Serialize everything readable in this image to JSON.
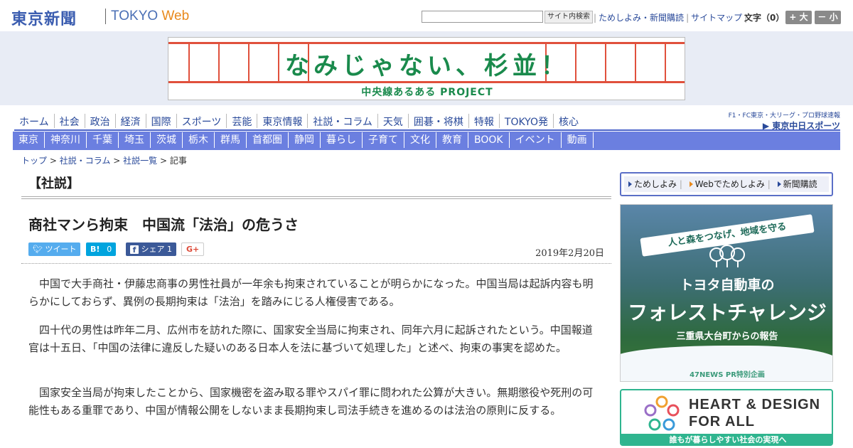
{
  "header": {
    "logo_jp": "東京新聞",
    "logo_tokyo": "TOKYO",
    "logo_web": "Web",
    "search_button": "サイト内検索",
    "links": [
      "ためしよみ・新聞購読",
      "サイトマップ"
    ],
    "font_size_label": "文字（0）",
    "font_plus": "+ 大",
    "font_minus": "－ 小"
  },
  "banner": {
    "title": "なみじゃない、杉並！",
    "subtitle": "中央線あるある PROJECT"
  },
  "nav_main": [
    "ホーム",
    "社会",
    "政治",
    "経済",
    "国際",
    "スポーツ",
    "芸能",
    "東京情報",
    "社説・コラム",
    "天気",
    "囲碁・将棋",
    "特報",
    "TOKYO発",
    "核心"
  ],
  "sports_link": {
    "line1": "F1・FC東京・大リーグ・プロ野球速報",
    "line2": "▶ 東京中日スポーツ"
  },
  "nav_regions": [
    "東京",
    "神奈川",
    "千葉",
    "埼玉",
    "茨城",
    "栃木",
    "群馬",
    "首都圏",
    "静岡",
    "暮らし",
    "子育て",
    "文化",
    "教育",
    "BOOK",
    "イベント",
    "動画"
  ],
  "breadcrumb": {
    "items": [
      "トップ",
      "社説・コラム",
      "社説一覧"
    ],
    "current": "記事",
    "separator": ">"
  },
  "article": {
    "section": "【社説】",
    "headline": "商社マンら拘束　中国流「法治」の危うさ",
    "date": "2019年2月20日",
    "share": {
      "tweet": "ツイート",
      "hatena_label": "B!",
      "hatena_count": "0",
      "facebook_label": "シェア",
      "facebook_count": "1",
      "gplus": "G+"
    },
    "paragraphs": [
      "中国で大手商社・伊藤忠商事の男性社員が一年余も拘束されていることが明らかになった。中国当局は起訴内容も明らかにしておらず、異例の長期拘束は「法治」を踏みにじる人権侵害である。",
      "四十代の男性は昨年二月、広州市を訪れた際に、国家安全当局に拘束され、同年六月に起訴されたという。中国報道官は十五日、「中国の法律に違反した疑いのある日本人を法に基づいて処理した」と述べ、拘束の事実を認めた。",
      "国家安全当局が拘束したことから、国家機密を盗み取る罪やスパイ罪に問われた公算が大きい。無期懲役や死刑の可能性もある重罪であり、中国が情報公開をしないまま長期拘束し司法手続きを進めるのは法治の原則に反する。"
    ]
  },
  "sidebar": {
    "subscribe_links": [
      "ためしよみ",
      "Webでためしよみ",
      "新聞購読"
    ],
    "ad1": {
      "ribbon": "人と森をつなげ、地域を守る",
      "line1": "トヨタ自動車の",
      "line2": "フォレストチャレンジ",
      "line3": "三重県大台町からの報告",
      "footer": "47NEWS PR特別企画"
    },
    "ad2": {
      "line1": "HEART & DESIGN",
      "line2": "FOR ALL",
      "bar": "誰もが暮らしやすい社会の実現へ"
    }
  },
  "colors": {
    "brand_blue": "#3b5db0",
    "nav_blue": "#6b7fe0",
    "web_orange": "#e8891c",
    "banner_green": "#1a8a4c",
    "twitter": "#55acee",
    "hatena": "#00a4de",
    "facebook": "#3b5998"
  }
}
